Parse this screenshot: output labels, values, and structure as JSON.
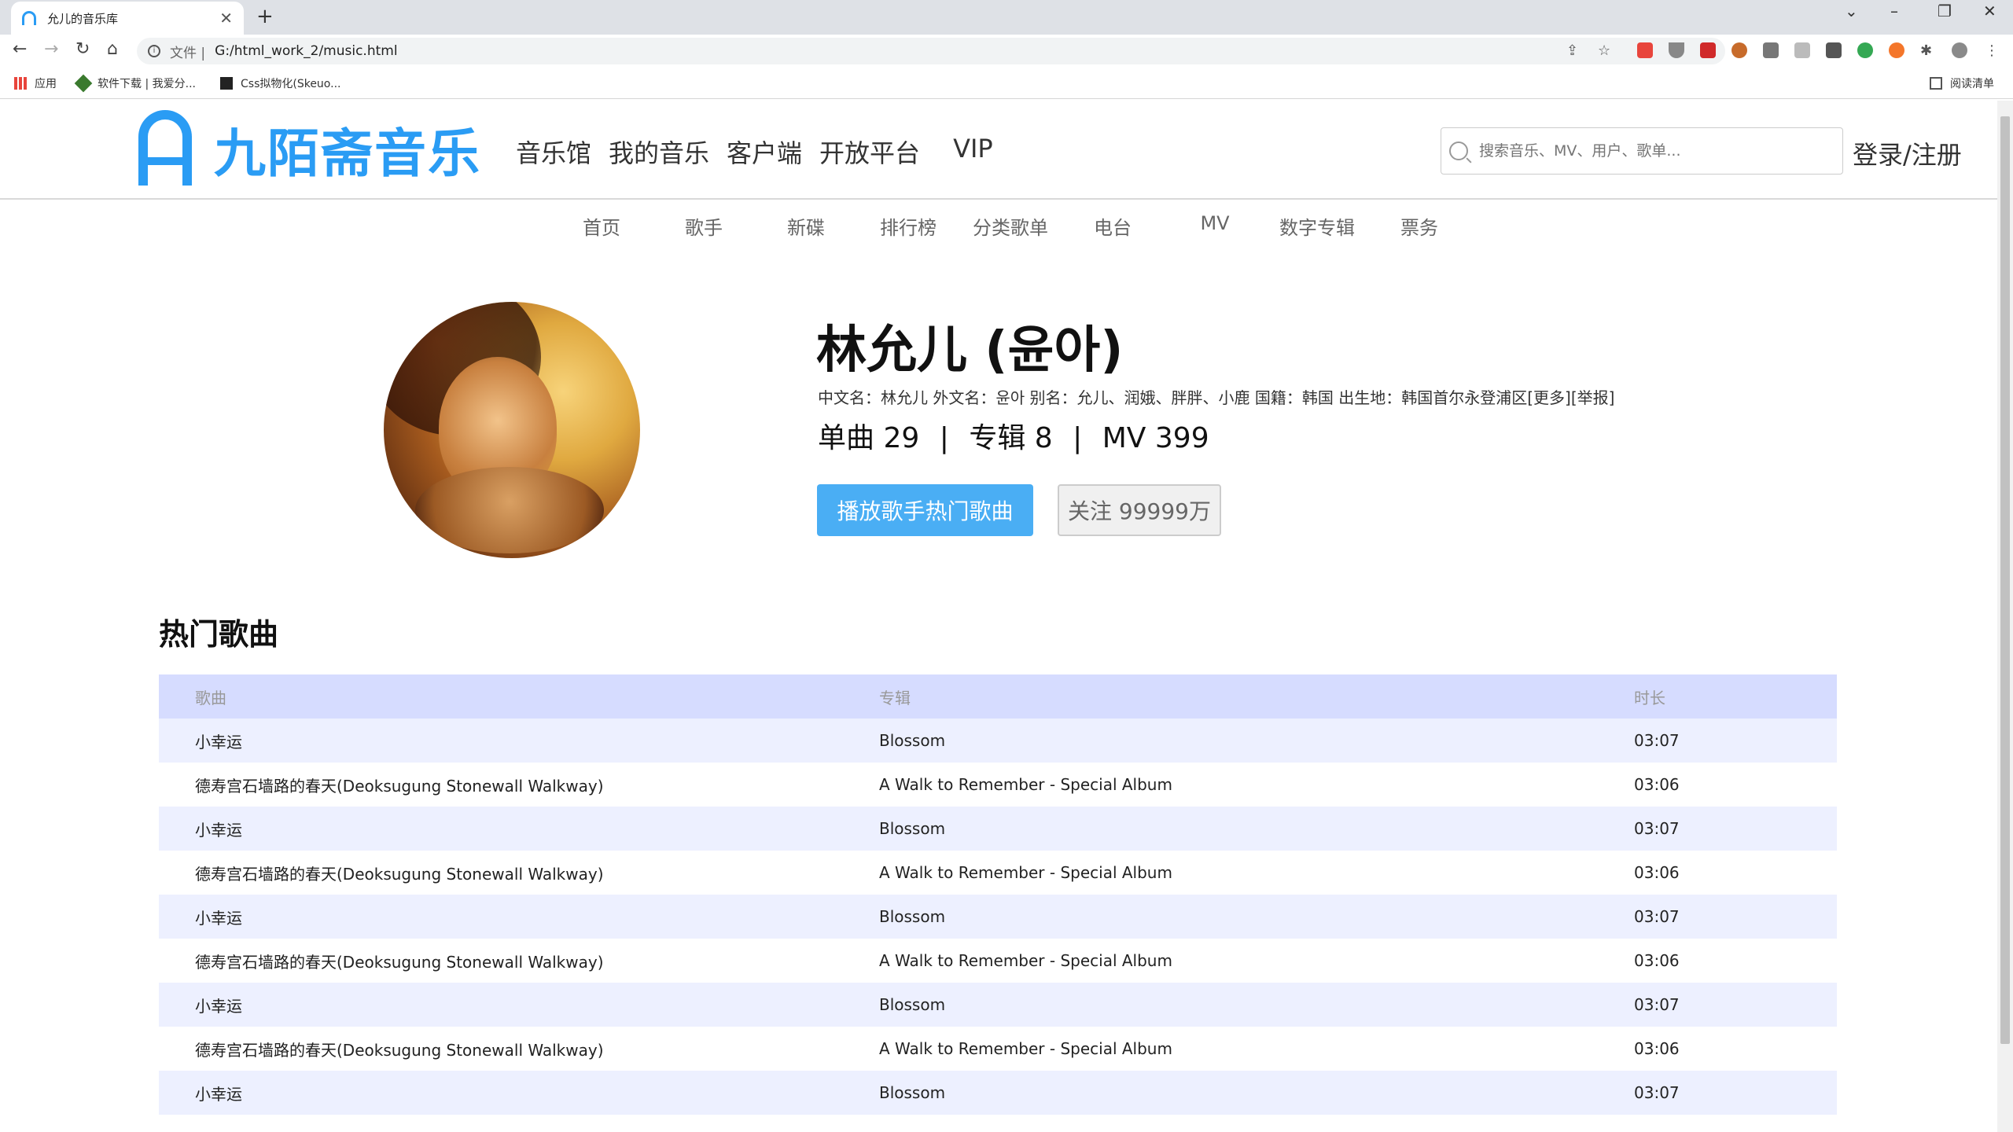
{
  "browser": {
    "tab_title": "允儿的音乐库",
    "scheme_label": "文件 |",
    "url": "G:/html_work_2/music.html",
    "bookmarks": [
      "应用",
      "软件下载 | 我爱分...",
      "Css拟物化(Skeuo..."
    ],
    "reading_list": "阅读清单"
  },
  "site": {
    "logo_text": "九陌斋音乐",
    "nav": [
      "音乐馆",
      "我的音乐",
      "客户端",
      "开放平台",
      "VIP"
    ],
    "search_placeholder": "搜索音乐、MV、用户、歌单...",
    "login": "登录/注册",
    "subnav": [
      "首页",
      "歌手",
      "新碟",
      "排行榜",
      "分类歌单",
      "电台",
      "MV",
      "数字专辑",
      "票务"
    ]
  },
  "artist": {
    "name": "林允儿 (윤아)",
    "meta": "中文名：林允儿 外文名：윤아 别名：允儿、润娥、胖胖、小鹿 国籍：韩国 出生地：韩国首尔永登浦区[更多][举报]",
    "stats": {
      "singles_label": "单曲",
      "singles": "29",
      "albums_label": "专辑",
      "albums": "8",
      "mv_label": "MV",
      "mv": "399",
      "sep": "|"
    },
    "play_button": "播放歌手热门歌曲",
    "follow_button": "关注 99999万"
  },
  "hot_songs": {
    "title": "热门歌曲",
    "headers": [
      "歌曲",
      "专辑",
      "时长"
    ],
    "rows": [
      [
        "小幸运",
        "Blossom",
        "03:07"
      ],
      [
        "德寿宫石墙路的春天(Deoksugung Stonewall Walkway)",
        "A Walk to Remember - Special Album",
        "03:06"
      ],
      [
        "小幸运",
        "Blossom",
        "03:07"
      ],
      [
        "德寿宫石墙路的春天(Deoksugung Stonewall Walkway)",
        "A Walk to Remember - Special Album",
        "03:06"
      ],
      [
        "小幸运",
        "Blossom",
        "03:07"
      ],
      [
        "德寿宫石墙路的春天(Deoksugung Stonewall Walkway)",
        "A Walk to Remember - Special Album",
        "03:06"
      ],
      [
        "小幸运",
        "Blossom",
        "03:07"
      ],
      [
        "德寿宫石墙路的春天(Deoksugung Stonewall Walkway)",
        "A Walk to Remember - Special Album",
        "03:06"
      ],
      [
        "小幸运",
        "Blossom",
        "03:07"
      ]
    ]
  },
  "colors": {
    "brand": "#2a9cf4",
    "table_header": "#d6dcff",
    "table_alt": "#edf0ff",
    "play_button": "#4aaef4"
  }
}
